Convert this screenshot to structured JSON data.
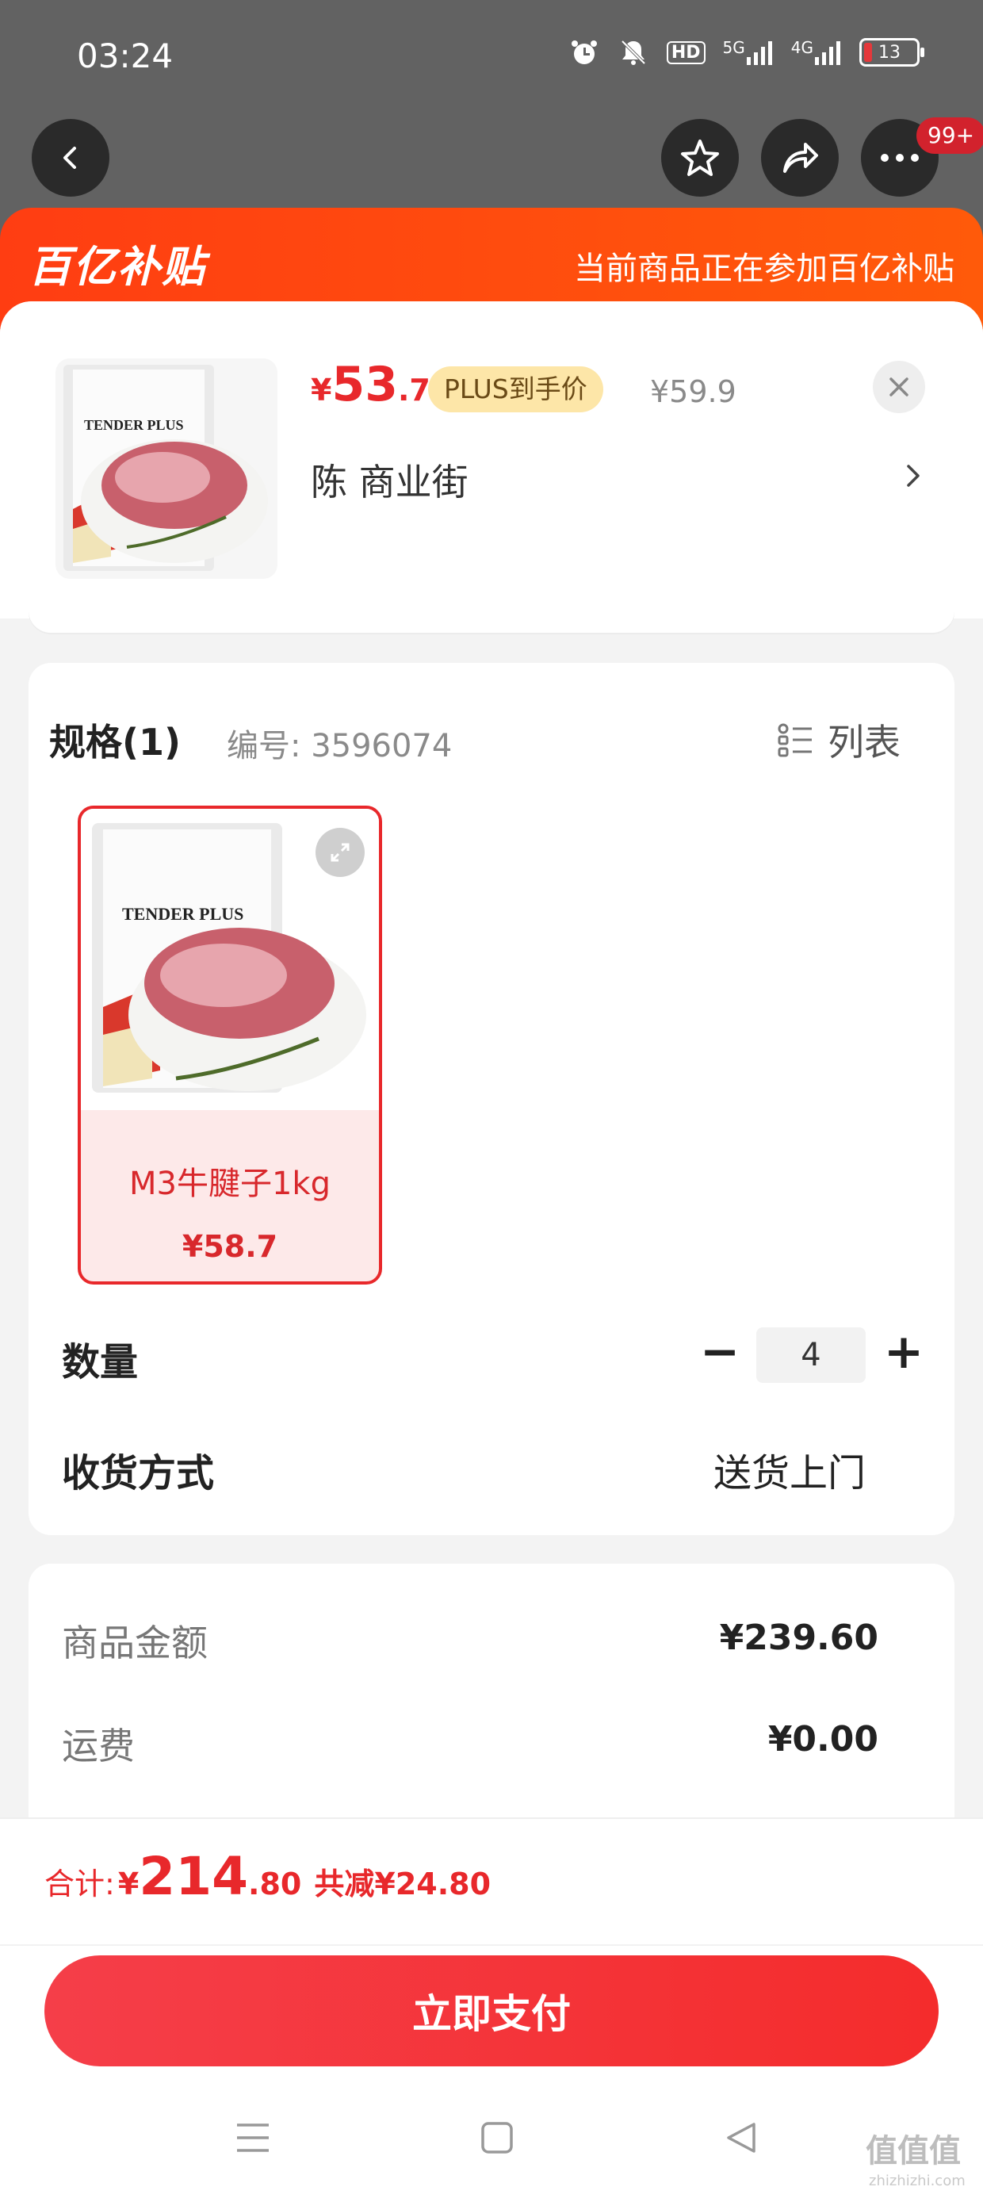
{
  "status": {
    "time": "03:24",
    "hd": "HD",
    "net1": "5G",
    "net2": "4G",
    "battery": "13"
  },
  "nav": {
    "more_badge": "99+"
  },
  "banner": {
    "logo": "百亿补贴",
    "text": "当前商品正在参加百亿补贴"
  },
  "product": {
    "price_currency": "¥",
    "price_int": "53",
    "price_dec": ".7",
    "plus_tag": "PLUS到手价",
    "original_price": "¥59.9",
    "shop": "陈  商业街",
    "thumb_brand": "TENDER PLUS"
  },
  "spec": {
    "title": "规格(1)",
    "number": "编号: 3596074",
    "list_label": "列表",
    "items": [
      {
        "brand": "TENDER PLUS",
        "name": "M3牛腱子1kg",
        "price": "¥58.7"
      }
    ]
  },
  "quantity": {
    "label": "数量",
    "minus": "−",
    "value": "4",
    "plus": "+"
  },
  "delivery": {
    "label": "收货方式",
    "value": "送货上门"
  },
  "amounts": {
    "goods_label": "商品金额",
    "goods_value": "¥239.60",
    "shipping_label": "运费",
    "shipping_value": "¥0.00"
  },
  "total": {
    "label": "合计:",
    "currency": "¥",
    "int": "214",
    "dec": ".80",
    "saving": "共减¥24.80"
  },
  "pay": {
    "label": "立即支付"
  },
  "watermark": {
    "text": "值值值",
    "sub": "zhizhizhi.com"
  },
  "colors": {
    "accent": "#e8282b",
    "banner": "#ff4a10",
    "plus_tag_bg": "#fde6a8"
  }
}
